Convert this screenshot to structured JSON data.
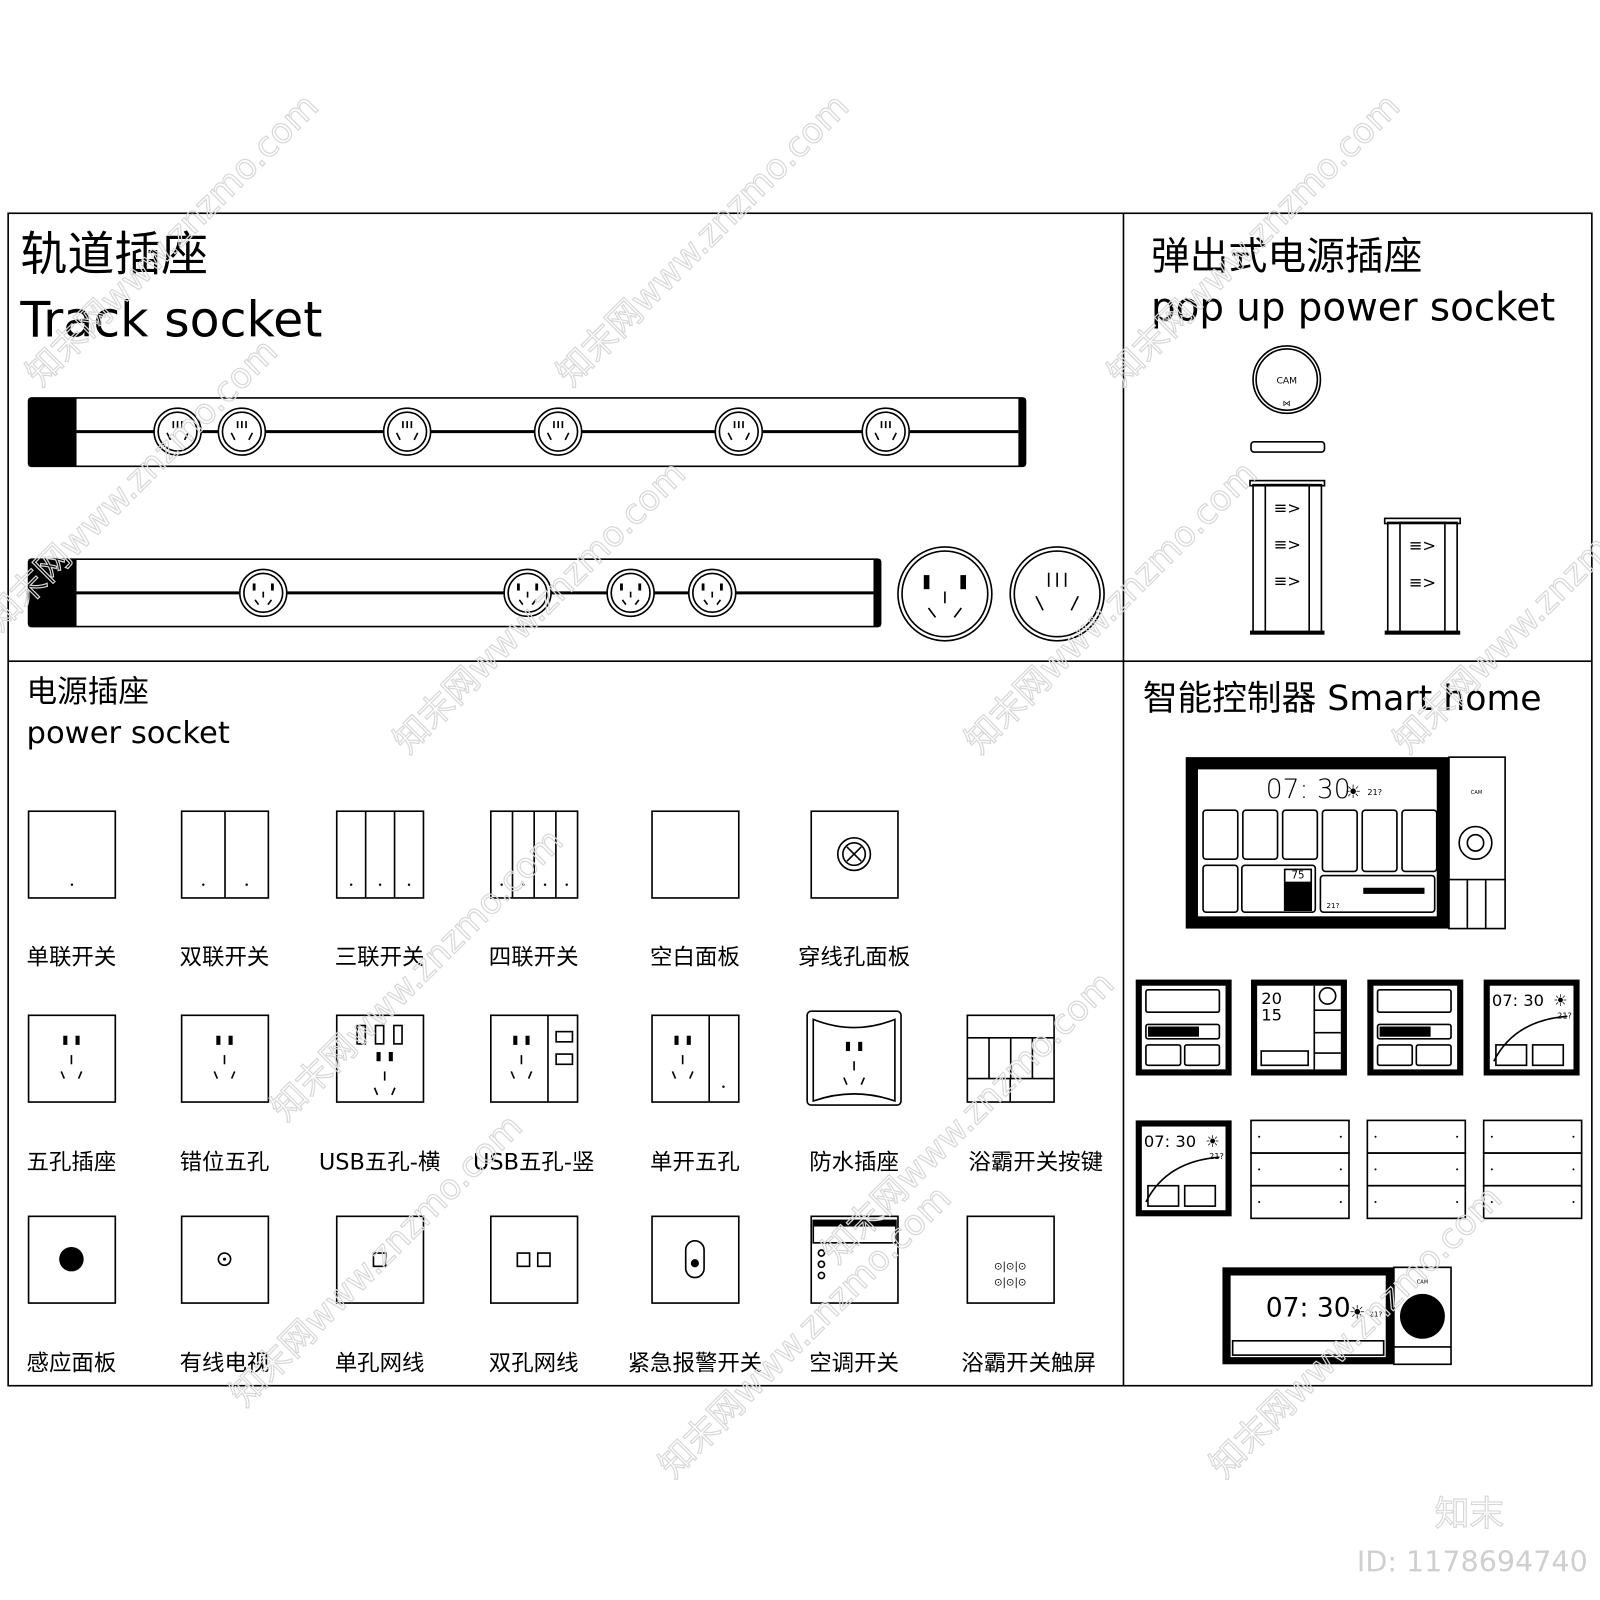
{
  "sections": {
    "track": {
      "title_cn": "轨道插座",
      "title_en": "Track socket"
    },
    "popup": {
      "title_cn": "弹出式电源插座",
      "title_en": "pop up power socket",
      "cap_label": "CAM"
    },
    "power": {
      "title_cn": "电源插座",
      "title_en": "power socket"
    },
    "smart": {
      "title": "智能控制器 Smart home"
    }
  },
  "power_items": [
    {
      "label": "单联开关",
      "type": "switch1"
    },
    {
      "label": "双联开关",
      "type": "switch2"
    },
    {
      "label": "三联开关",
      "type": "switch3"
    },
    {
      "label": "四联开关",
      "type": "switch4"
    },
    {
      "label": "空白面板",
      "type": "blank"
    },
    {
      "label": "穿线孔面板",
      "type": "cable"
    },
    {
      "label": "五孔插座",
      "type": "five"
    },
    {
      "label": "错位五孔",
      "type": "five-offset"
    },
    {
      "label": "USB五孔-横",
      "type": "usb-h"
    },
    {
      "label": "USB五孔-竖",
      "type": "usb-v"
    },
    {
      "label": "单开五孔",
      "type": "five-switch"
    },
    {
      "label": "防水插座",
      "type": "waterproof"
    },
    {
      "label": "浴霸开关按键",
      "type": "bath-keys"
    },
    {
      "label": "感应面板",
      "type": "sensor"
    },
    {
      "label": "有线电视",
      "type": "tv"
    },
    {
      "label": "单孔网线",
      "type": "net1"
    },
    {
      "label": "双孔网线",
      "type": "net2"
    },
    {
      "label": "紧急报警开关",
      "type": "alarm"
    },
    {
      "label": "空调开关",
      "type": "ac"
    },
    {
      "label": "浴霸开关触屏",
      "type": "bath-touch"
    }
  ],
  "smart_panels": {
    "main_time": "07: 30",
    "temp": "21?",
    "level": "75",
    "clock_small": [
      "20",
      "15"
    ],
    "brand": "CAM"
  },
  "watermark": {
    "text": "知末网www.znzmo.com",
    "logo": "知末",
    "id": "ID: 1178694740"
  }
}
